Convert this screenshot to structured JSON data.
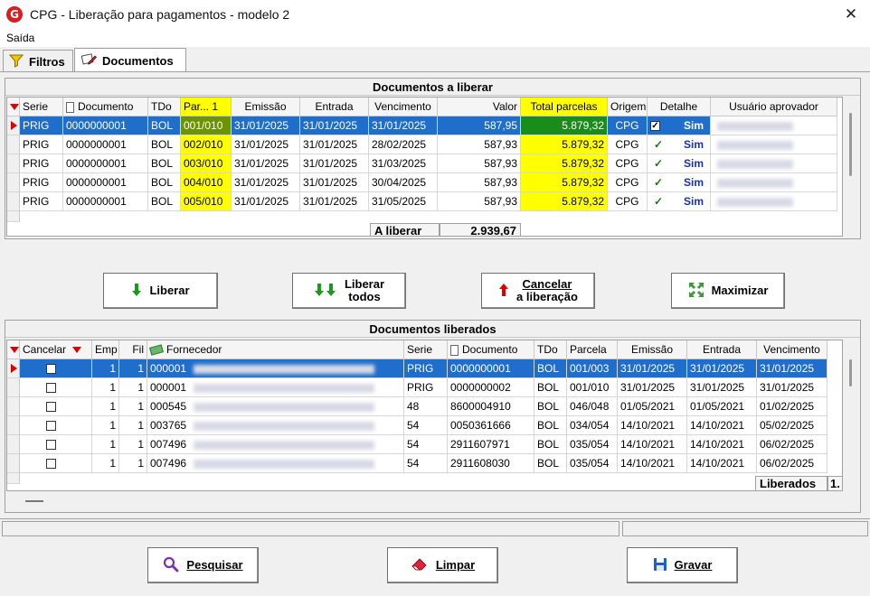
{
  "window": {
    "title": "CPG - Liberação para pagamentos - modelo 2",
    "close_glyph": "✕",
    "logo": "G"
  },
  "menu": {
    "items": [
      "Saída"
    ]
  },
  "tabs": [
    {
      "label": "Filtros",
      "icon": "funnel-icon"
    },
    {
      "label": "Documentos",
      "icon": "document-pen-icon"
    }
  ],
  "pending": {
    "title": "Documentos a liberar",
    "columns": [
      "Serie",
      "Documento",
      "TDo",
      "Par... 1",
      "Emissão",
      "Entrada",
      "Vencimento",
      "Valor",
      "Total parcelas",
      "Origem",
      "Detalhe",
      "Usuário aprovador"
    ],
    "rows": [
      {
        "serie": "PRIG",
        "documento": "0000000001",
        "tdo": "BOL",
        "parcela": "001/010",
        "emissao": "31/01/2025",
        "entrada": "31/01/2025",
        "vencimento": "31/01/2025",
        "valor": "587,95",
        "total": "5.879,32",
        "origem": "CPG",
        "detalhe": "Sim",
        "selected": true
      },
      {
        "serie": "PRIG",
        "documento": "0000000001",
        "tdo": "BOL",
        "parcela": "002/010",
        "emissao": "31/01/2025",
        "entrada": "31/01/2025",
        "vencimento": "28/02/2025",
        "valor": "587,93",
        "total": "5.879,32",
        "origem": "CPG",
        "detalhe": "Sim"
      },
      {
        "serie": "PRIG",
        "documento": "0000000001",
        "tdo": "BOL",
        "parcela": "003/010",
        "emissao": "31/01/2025",
        "entrada": "31/01/2025",
        "vencimento": "31/03/2025",
        "valor": "587,93",
        "total": "5.879,32",
        "origem": "CPG",
        "detalhe": "Sim"
      },
      {
        "serie": "PRIG",
        "documento": "0000000001",
        "tdo": "BOL",
        "parcela": "004/010",
        "emissao": "31/01/2025",
        "entrada": "31/01/2025",
        "vencimento": "30/04/2025",
        "valor": "587,93",
        "total": "5.879,32",
        "origem": "CPG",
        "detalhe": "Sim"
      },
      {
        "serie": "PRIG",
        "documento": "0000000001",
        "tdo": "BOL",
        "parcela": "005/010",
        "emissao": "31/01/2025",
        "entrada": "31/01/2025",
        "vencimento": "31/05/2025",
        "valor": "587,93",
        "total": "5.879,32",
        "origem": "CPG",
        "detalhe": "Sim"
      }
    ],
    "total_label": "A liberar",
    "total_value": "2.939,67"
  },
  "actions": {
    "liberar": "Liberar",
    "liberar_todos_1": "Liberar",
    "liberar_todos_2": "todos",
    "cancelar_1": "Cancelar",
    "cancelar_2": "a liberação",
    "maximizar": "Maximizar"
  },
  "released": {
    "title": "Documentos liberados",
    "columns": [
      "Cancelar",
      "Emp",
      "Fil",
      "Fornecedor",
      "Serie",
      "Documento",
      "TDo",
      "Parcela",
      "Emissão",
      "Entrada",
      "Vencimento"
    ],
    "rows": [
      {
        "emp": "1",
        "fil": "1",
        "fornecedor": "000001",
        "serie": "PRIG",
        "documento": "0000000001",
        "tdo": "BOL",
        "parcela": "001/003",
        "emissao": "31/01/2025",
        "entrada": "31/01/2025",
        "vencimento": "31/01/2025",
        "selected": true
      },
      {
        "emp": "1",
        "fil": "1",
        "fornecedor": "000001",
        "serie": "PRIG",
        "documento": "0000000002",
        "tdo": "BOL",
        "parcela": "001/010",
        "emissao": "31/01/2025",
        "entrada": "31/01/2025",
        "vencimento": "31/01/2025"
      },
      {
        "emp": "1",
        "fil": "1",
        "fornecedor": "000545",
        "serie": "48",
        "documento": "8600004910",
        "tdo": "BOL",
        "parcela": "046/048",
        "emissao": "01/05/2021",
        "entrada": "01/05/2021",
        "vencimento": "01/02/2025"
      },
      {
        "emp": "1",
        "fil": "1",
        "fornecedor": "003765",
        "serie": "54",
        "documento": "0050361666",
        "tdo": "BOL",
        "parcela": "034/054",
        "emissao": "14/10/2021",
        "entrada": "14/10/2021",
        "vencimento": "05/02/2025"
      },
      {
        "emp": "1",
        "fil": "1",
        "fornecedor": "007496",
        "serie": "54",
        "documento": "2911607971",
        "tdo": "BOL",
        "parcela": "035/054",
        "emissao": "14/10/2021",
        "entrada": "14/10/2021",
        "vencimento": "06/02/2025"
      },
      {
        "emp": "1",
        "fil": "1",
        "fornecedor": "007496",
        "serie": "54",
        "documento": "2911608030",
        "tdo": "BOL",
        "parcela": "035/054",
        "emissao": "14/10/2021",
        "entrada": "14/10/2021",
        "vencimento": "06/02/2025"
      }
    ],
    "total_label": "Liberados",
    "total_value": "1."
  },
  "footer": {
    "pesquisar": "Pesquisar",
    "limpar": "Limpar",
    "gravar": "Gravar"
  },
  "colors": {
    "highlight_yellow": "#ffff00",
    "selection_blue": "#1f6ecb",
    "marker_red": "#dd0000",
    "green_arrow": "#1a9a1a"
  }
}
